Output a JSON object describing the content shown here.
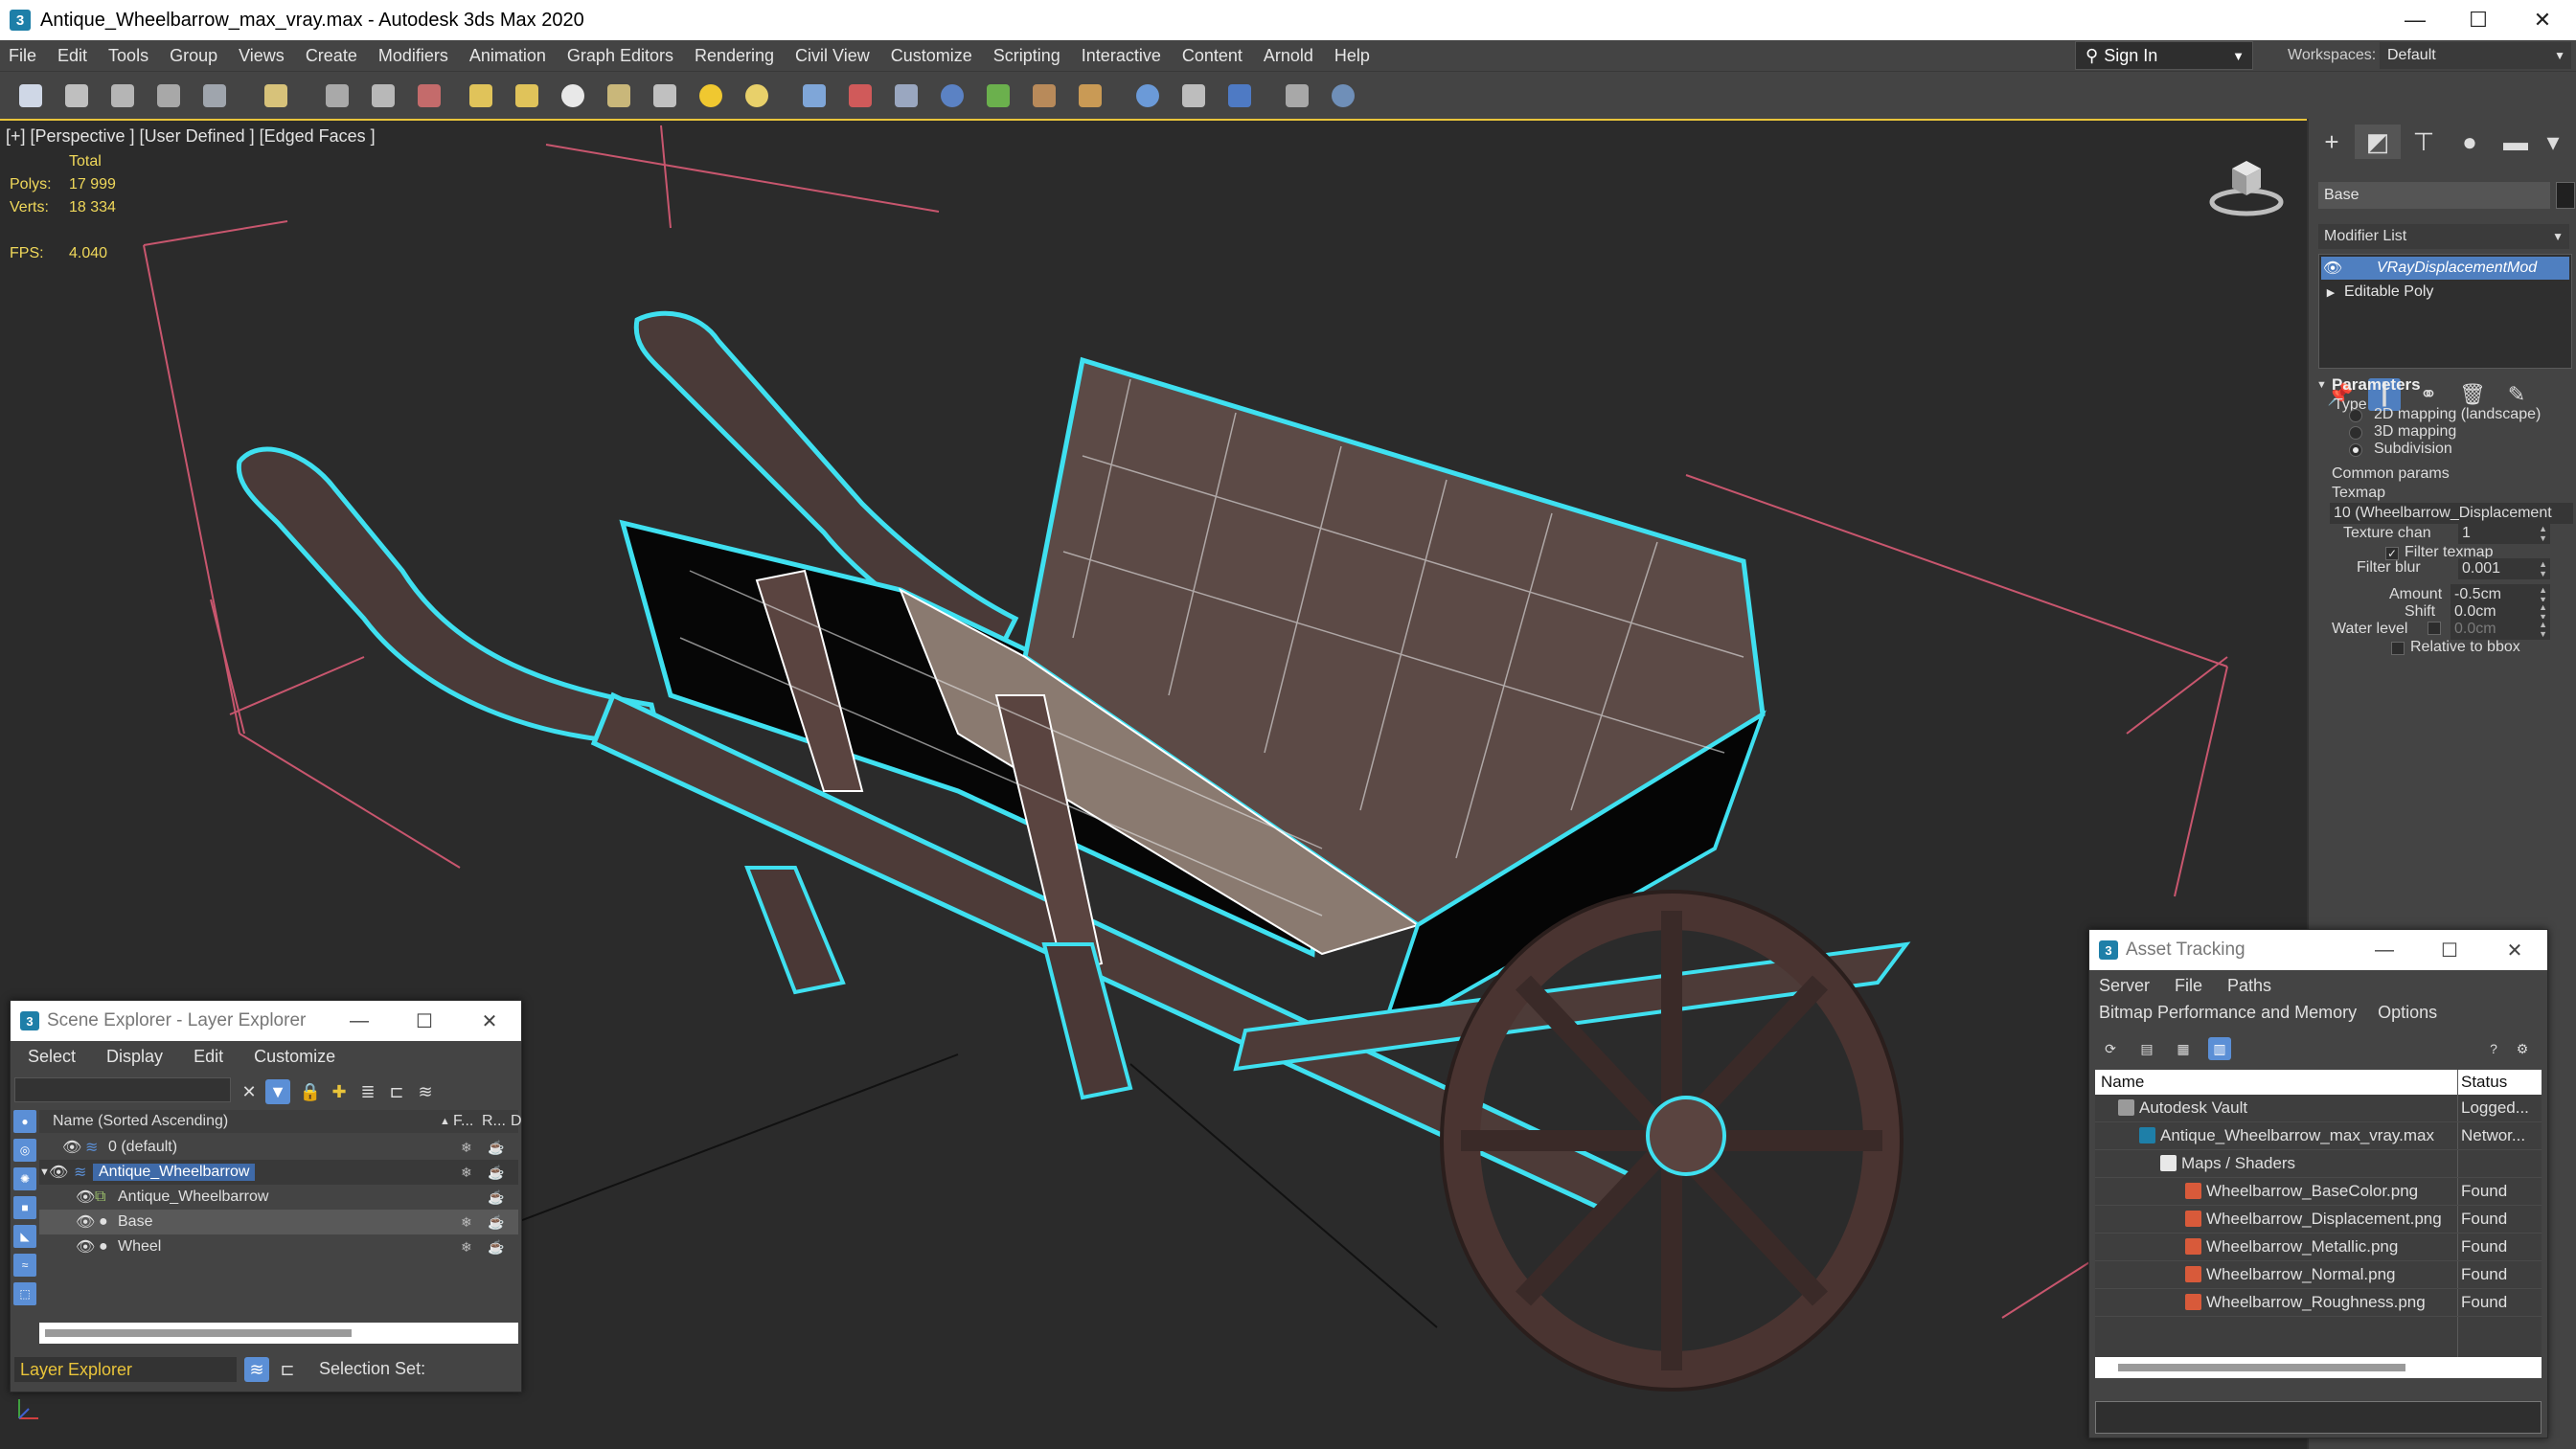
{
  "window": {
    "title": "Antique_Wheelbarrow_max_vray.max - Autodesk 3ds Max 2020",
    "minimize": "—",
    "maximize": "☐",
    "close": "✕"
  },
  "menu": [
    "File",
    "Edit",
    "Tools",
    "Group",
    "Views",
    "Create",
    "Modifiers",
    "Animation",
    "Graph Editors",
    "Rendering",
    "Civil View",
    "Customize",
    "Scripting",
    "Interactive",
    "Content",
    "Arnold",
    "Help"
  ],
  "account": {
    "signin": "Sign In",
    "workspaces_label": "Workspaces:",
    "workspace": "Default"
  },
  "viewport": {
    "label": "[+] [Perspective ] [User Defined ] [Edged Faces ]",
    "stats": {
      "total_label": "Total",
      "polys_label": "Polys:",
      "polys": "17 999",
      "verts_label": "Verts:",
      "verts": "18 334",
      "fps_label": "FPS:",
      "fps": "4.040"
    }
  },
  "command_panel": {
    "object_name": "Base",
    "modifier_list": "Modifier List",
    "stack": [
      "VRayDisplacementMod",
      "Editable Poly"
    ],
    "parameters": {
      "title": "Parameters",
      "type_label": "Type",
      "type_options": [
        "2D mapping (landscape)",
        "3D mapping",
        "Subdivision"
      ],
      "type_selected": "Subdivision",
      "common_label": "Common params",
      "texmap_label": "Texmap",
      "texmap_value": "10 (Wheelbarrow_Displacement",
      "texture_chan_label": "Texture chan",
      "texture_chan": "1",
      "filter_texmap_label": "Filter texmap",
      "filter_blur_label": "Filter blur",
      "filter_blur": "0.001",
      "amount_label": "Amount",
      "amount": "-0.5cm",
      "shift_label": "Shift",
      "shift": "0.0cm",
      "water_level_label": "Water level",
      "water_level": "0.0cm",
      "relative_bbox_label": "Relative to bbox"
    }
  },
  "scene_explorer": {
    "title": "Scene Explorer - Layer Explorer",
    "menu": [
      "Select",
      "Display",
      "Edit",
      "Customize"
    ],
    "header": {
      "name": "Name (Sorted Ascending)",
      "c1": "F...",
      "c2": "R...",
      "c3": "D"
    },
    "rows": [
      {
        "label": "0 (default)"
      },
      {
        "label": "Antique_Wheelbarrow"
      },
      {
        "label": "Antique_Wheelbarrow"
      },
      {
        "label": "Base"
      },
      {
        "label": "Wheel"
      }
    ],
    "footer": {
      "layer_select": "Layer Explorer",
      "selection_set": "Selection Set:"
    }
  },
  "asset_tracking": {
    "title": "Asset Tracking",
    "menu1": [
      "Server",
      "File",
      "Paths"
    ],
    "menu2": [
      "Bitmap Performance and Memory",
      "Options"
    ],
    "columns": {
      "name": "Name",
      "status": "Status"
    },
    "rows": [
      {
        "name": "Autodesk Vault",
        "status": "Logged..."
      },
      {
        "name": "Antique_Wheelbarrow_max_vray.max",
        "status": "Networ..."
      },
      {
        "name": "Maps / Shaders",
        "status": ""
      },
      {
        "name": "Wheelbarrow_BaseColor.png",
        "status": "Found"
      },
      {
        "name": "Wheelbarrow_Displacement.png",
        "status": "Found"
      },
      {
        "name": "Wheelbarrow_Metallic.png",
        "status": "Found"
      },
      {
        "name": "Wheelbarrow_Normal.png",
        "status": "Found"
      },
      {
        "name": "Wheelbarrow_Roughness.png",
        "status": "Found"
      }
    ]
  },
  "colors": {
    "selection_outline": "#3fe0f0",
    "highlight_blue": "#4f7fc0",
    "stats_yellow": "#f0d85a",
    "viewport_border": "#e9c43a",
    "grid_pink": "#c8566e"
  }
}
